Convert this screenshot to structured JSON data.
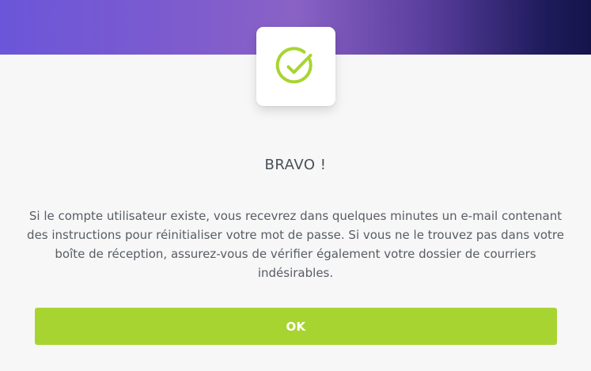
{
  "colors": {
    "accent": "#a8d431",
    "header_gradient": [
      "#6b56d9",
      "#8a62c6",
      "#15144a"
    ],
    "title": "#4a4f57",
    "text": "#585d64"
  },
  "icon": "check-circle-icon",
  "dialog": {
    "title": "BRAVO !",
    "message": "Si le compte utilisateur existe, vous recevrez dans quelques minutes un e-mail contenant des instructions pour réinitialiser votre mot de passe. Si vous ne le trouvez pas dans votre boîte de réception, assurez-vous de vérifier également votre dossier de courriers indésirables.",
    "ok_label": "OK"
  }
}
